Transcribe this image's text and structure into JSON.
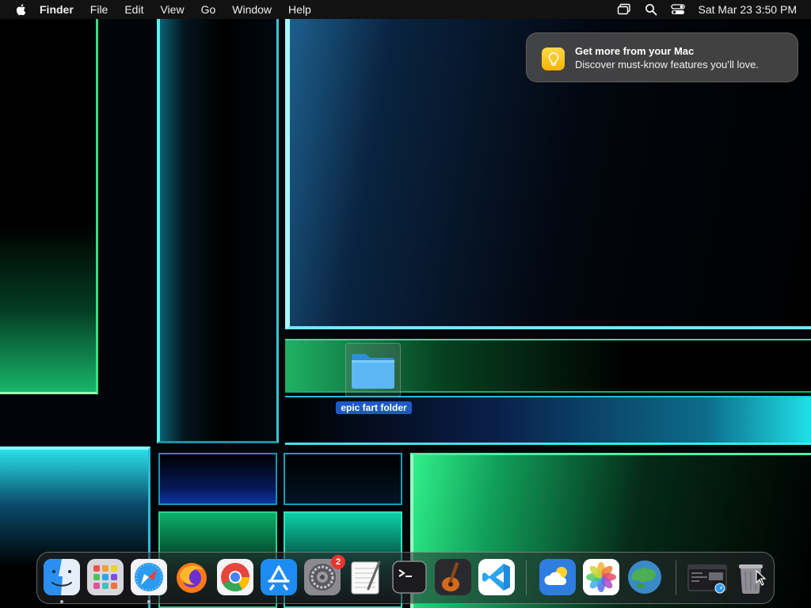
{
  "menubar": {
    "app_name": "Finder",
    "menus": [
      "File",
      "Edit",
      "View",
      "Go",
      "Window",
      "Help"
    ],
    "clock": "Sat Mar 23  3:50 PM",
    "status_icons": [
      "screen-mirroring-icon",
      "spotlight-search-icon",
      "control-center-icon"
    ]
  },
  "notification": {
    "title": "Get more from your Mac",
    "body": "Discover must-know features you’ll love.",
    "icon": "lightbulb-icon",
    "icon_color": "#f7c21a"
  },
  "desktop": {
    "items": [
      {
        "label": "epic fart folder",
        "icon": "folder-icon",
        "selected": true
      }
    ]
  },
  "dock": {
    "apps": [
      {
        "name": "Finder",
        "icon": "finder-icon",
        "running": true
      },
      {
        "name": "Launchpad",
        "icon": "launchpad-icon",
        "running": false
      },
      {
        "name": "Safari",
        "icon": "safari-icon",
        "running": true
      },
      {
        "name": "Firefox",
        "icon": "firefox-icon",
        "running": false
      },
      {
        "name": "Google Chrome",
        "icon": "chrome-icon",
        "running": false
      },
      {
        "name": "App Store",
        "icon": "app-store-icon",
        "running": false
      },
      {
        "name": "System Settings",
        "icon": "system-settings-icon",
        "running": false,
        "badge": "2"
      },
      {
        "name": "TextEdit",
        "icon": "textedit-icon",
        "running": false
      },
      {
        "name": "Terminal",
        "icon": "terminal-icon",
        "running": false
      },
      {
        "name": "GarageBand",
        "icon": "garageband-icon",
        "running": false
      },
      {
        "name": "Visual Studio Code",
        "icon": "vscode-icon",
        "running": false
      },
      {
        "name": "Weather",
        "icon": "weather-icon",
        "running": false
      },
      {
        "name": "Photos",
        "icon": "photos-icon",
        "running": false
      },
      {
        "name": "World Map",
        "icon": "world-map-icon",
        "running": false
      },
      {
        "name": "Safari Window",
        "icon": "minimized-window-icon",
        "running": false
      },
      {
        "name": "Trash",
        "icon": "trash-icon",
        "running": false
      }
    ]
  },
  "colors": {
    "menubar_bg": "#141414",
    "selection_blue": "#1c5ac8",
    "badge_red": "#e8352e"
  }
}
